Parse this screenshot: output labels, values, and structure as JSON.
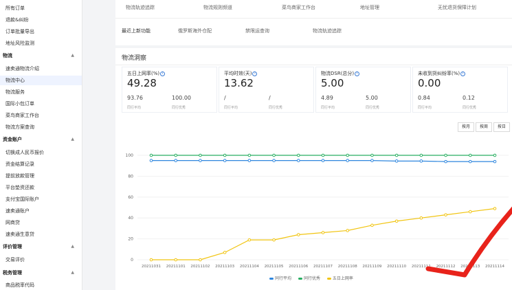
{
  "sidebar": {
    "items_top": [
      "所有订单",
      "退款&纠纷",
      "订单批量导出",
      "地址风险监测"
    ],
    "group_logistics": "物流",
    "items_logistics": [
      "速卖通物流介绍",
      "物流中心",
      "物流服务",
      "国际小包订单",
      "菜鸟商家工作台",
      "物流方案查询"
    ],
    "group_funds": "资金账户",
    "items_funds": [
      "切换成人民币报价",
      "资金结算记录",
      "提前放款管理",
      "平台垫资还款",
      "支付宝国际账户",
      "速卖通账户",
      "网商贷",
      "速卖通生意贷"
    ],
    "group_reviews": "评价管理",
    "items_reviews": [
      "交易评价"
    ],
    "group_tax": "税务管理",
    "items_tax": [
      "商品税率代码"
    ],
    "active": "物流中心"
  },
  "toolbar": {
    "row1": [
      "物流轨迹追踪",
      "物流规则频道",
      "菜鸟商家工作台",
      "地址管理",
      "无忧退货保障计划"
    ],
    "row2_lead": "最近上新功能",
    "row2": [
      "俄罗斯海外仓配",
      "禁限运查询",
      "物流轨迹追踪"
    ]
  },
  "panel": {
    "title": "物流洞察",
    "cards": [
      {
        "label": "五日上网率(%)",
        "value": "49.28",
        "peer_avg": "93.76",
        "peer_best": "100.00",
        "peer_avg_label": "同行平均",
        "peer_best_label": "同行优秀"
      },
      {
        "label": "平均时效(天)",
        "value": "13.62",
        "peer_avg": "/",
        "peer_best": "/",
        "peer_avg_label": "同行平均",
        "peer_best_label": "同行优秀"
      },
      {
        "label": "物流DSR(总分)",
        "value": "5.00",
        "peer_avg": "4.89",
        "peer_best": "5.00",
        "peer_avg_label": "同行平均",
        "peer_best_label": "同行优秀"
      },
      {
        "label": "未收到货纠纷率(%)",
        "value": "0.00",
        "peer_avg": "0.84",
        "peer_best": "0.12",
        "peer_avg_label": "同行平均",
        "peer_best_label": "同行优秀"
      }
    ],
    "range_buttons": [
      "按月",
      "按周",
      "按日"
    ]
  },
  "chart_data": {
    "type": "line",
    "x": [
      "20211031",
      "20211101",
      "20211102",
      "20211103",
      "20211104",
      "20211105",
      "20211106",
      "20211107",
      "20211108",
      "20211109",
      "20211110",
      "20211111",
      "20211112",
      "20211113",
      "20211114"
    ],
    "ylim": [
      0,
      100
    ],
    "yticks": [
      0,
      20,
      40,
      60,
      80,
      100
    ],
    "grid": true,
    "legend_position": "bottom",
    "series": [
      {
        "name": "同行平均",
        "color": "#2e86de",
        "values": [
          95,
          95,
          95,
          95,
          95,
          95,
          95,
          95,
          95,
          95,
          94.5,
          94.5,
          94,
          94,
          94
        ]
      },
      {
        "name": "同行优秀",
        "color": "#27ae60",
        "values": [
          100,
          100,
          100,
          100,
          100,
          100,
          100,
          100,
          100,
          100,
          100,
          100,
          100,
          100,
          100
        ]
      },
      {
        "name": "五日上网率",
        "color": "#f1c40f",
        "values": [
          0,
          0,
          0,
          7,
          19,
          19,
          24,
          26,
          28,
          33,
          37,
          40,
          43,
          46,
          49
        ]
      }
    ]
  }
}
